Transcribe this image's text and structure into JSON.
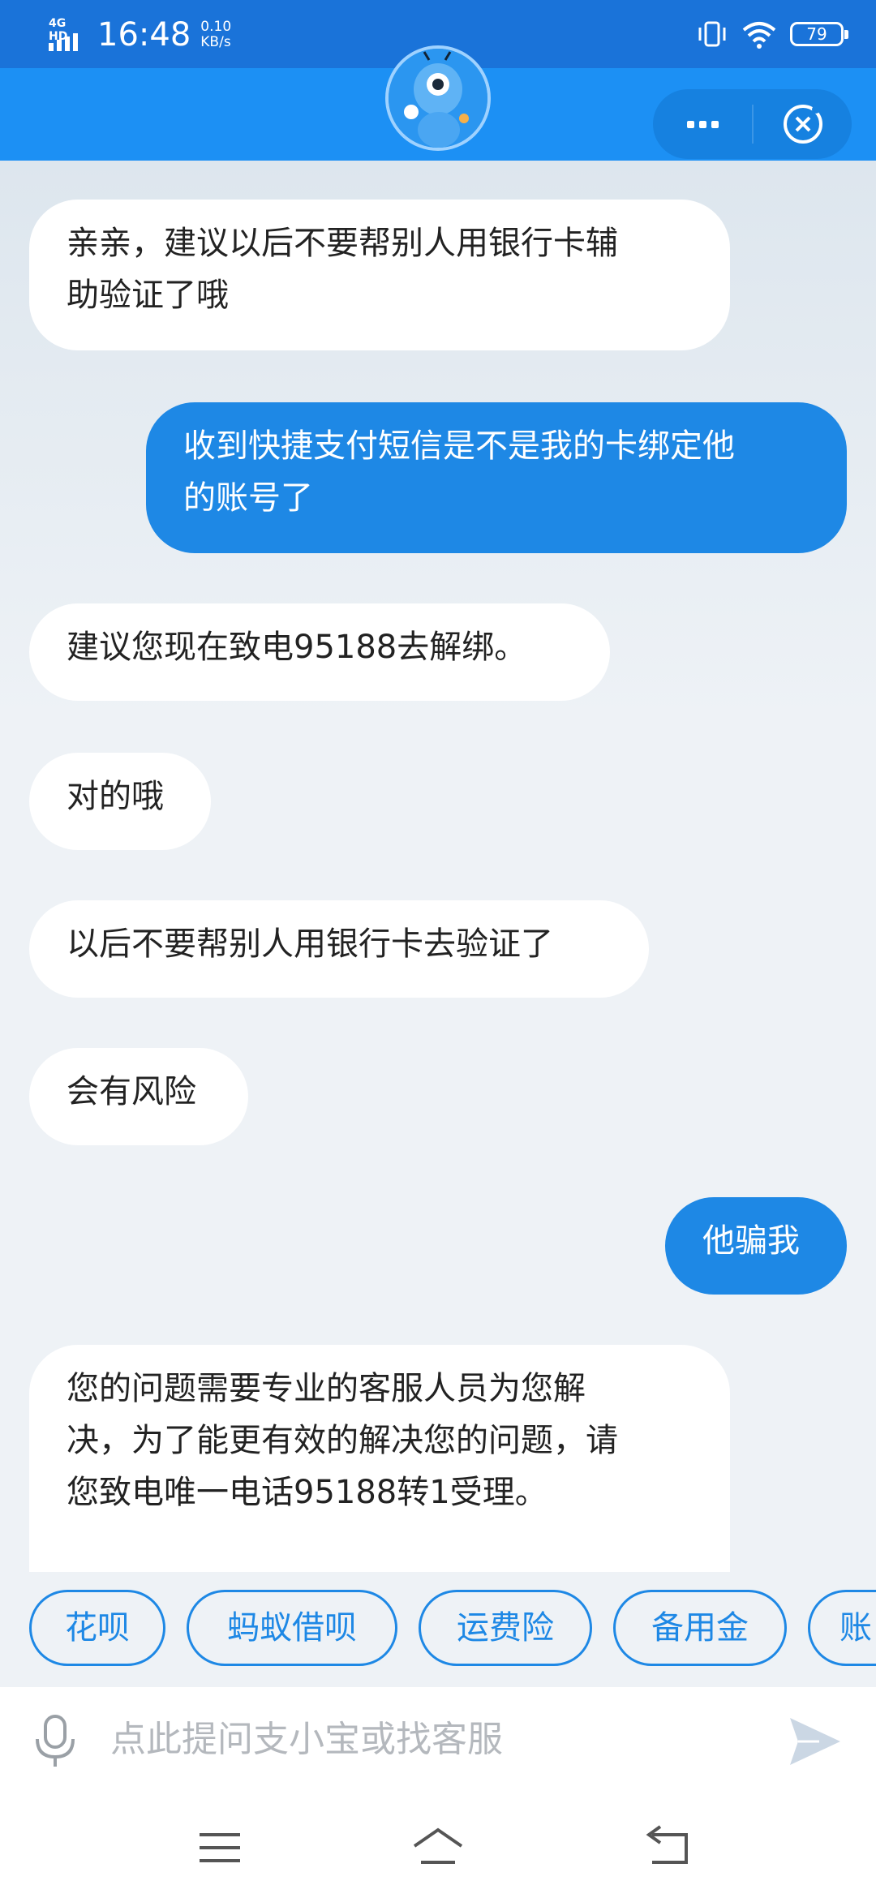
{
  "status_bar": {
    "network": "4G HD",
    "time": "16:48",
    "speed_value": "0.10",
    "speed_unit": "KB/s",
    "battery": "79"
  },
  "header": {
    "mascot": "ant-mascot-avatar",
    "more_icon": "more-dots-icon",
    "close_icon": "close-circle-icon"
  },
  "messages": [
    {
      "sender": "bot",
      "lines": [
        "亲亲，建议以后不要帮别人用银行卡辅",
        "助验证了哦"
      ]
    },
    {
      "sender": "user",
      "lines": [
        "收到快捷支付短信是不是我的卡绑定他",
        "的账号了"
      ]
    },
    {
      "sender": "bot",
      "lines": [
        "建议您现在致电95188去解绑。"
      ]
    },
    {
      "sender": "bot",
      "lines": [
        "对的哦"
      ]
    },
    {
      "sender": "bot",
      "lines": [
        "以后不要帮别人用银行卡去验证了"
      ]
    },
    {
      "sender": "bot",
      "lines": [
        "会有风险"
      ]
    },
    {
      "sender": "user",
      "lines": [
        "他骗我"
      ]
    },
    {
      "sender": "bot",
      "lines": [
        "您的问题需要专业的客服人员为您解",
        "决，为了能更有效的解决您的问题，请",
        "您致电唯一电话95188转1受理。"
      ]
    }
  ],
  "quick_replies": [
    "花呗",
    "蚂蚁借呗",
    "运费险",
    "备用金",
    "账"
  ],
  "input": {
    "placeholder": "点此提问支小宝或找客服",
    "mic_icon": "microphone-icon",
    "send_icon": "send-arrow-icon"
  },
  "nav": {
    "menu_icon": "menu-icon",
    "home_icon": "home-icon",
    "back_icon": "back-icon"
  },
  "colors": {
    "header_blue": "#1c90f4",
    "status_blue": "#1a73d9",
    "user_bubble": "#1e88e5",
    "bot_bubble": "#ffffff",
    "chip_border": "#1e88e5"
  }
}
